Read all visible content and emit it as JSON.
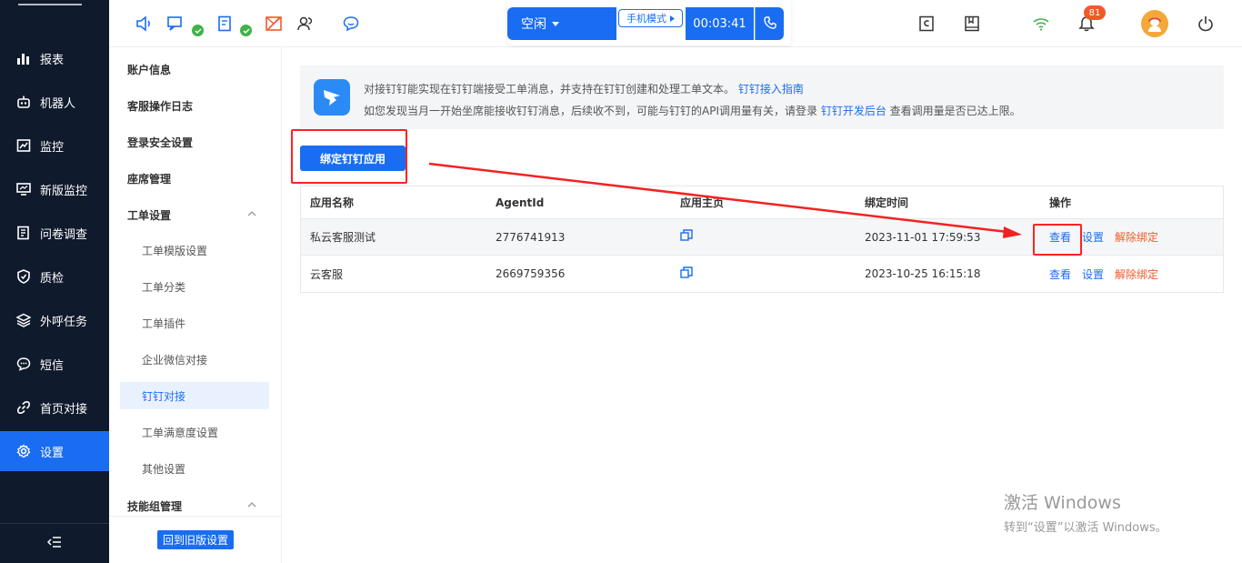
{
  "sidebar": {
    "items": [
      {
        "label": "报表",
        "icon": "bar-chart-icon"
      },
      {
        "label": "机器人",
        "icon": "robot-icon"
      },
      {
        "label": "监控",
        "icon": "monitor-chart-icon"
      },
      {
        "label": "新版监控",
        "icon": "screen-monitor-icon"
      },
      {
        "label": "问卷调查",
        "icon": "survey-icon"
      },
      {
        "label": "质检",
        "icon": "shield-check-icon"
      },
      {
        "label": "外呼任务",
        "icon": "layers-icon"
      },
      {
        "label": "短信",
        "icon": "message-icon"
      },
      {
        "label": "首页对接",
        "icon": "link-icon"
      },
      {
        "label": "设置",
        "icon": "gear-icon"
      }
    ],
    "active_index": 9,
    "collapse_icon": "collapse-menu-icon"
  },
  "header": {
    "call": {
      "status_label": "空闲",
      "mode_label": "手机模式",
      "timer": "00:03:41"
    },
    "notification_count": "81"
  },
  "submenu": {
    "items": [
      {
        "label": "账户信息",
        "type": "group"
      },
      {
        "label": "客服操作日志",
        "type": "group"
      },
      {
        "label": "登录安全设置",
        "type": "group"
      },
      {
        "label": "座席管理",
        "type": "group"
      },
      {
        "label": "工单设置",
        "type": "group",
        "expanded": true
      },
      {
        "label": "工单模版设置",
        "type": "child"
      },
      {
        "label": "工单分类",
        "type": "child"
      },
      {
        "label": "工单插件",
        "type": "child"
      },
      {
        "label": "企业微信对接",
        "type": "child"
      },
      {
        "label": "钉钉对接",
        "type": "child",
        "active": true
      },
      {
        "label": "工单满意度设置",
        "type": "child"
      },
      {
        "label": "其他设置",
        "type": "child"
      },
      {
        "label": "技能组管理",
        "type": "group",
        "expanded": true
      }
    ],
    "footer_button": "回到旧版设置"
  },
  "content": {
    "info": {
      "line1_text": "对接钉钉能实现在钉钉端接受工单消息，并支持在钉钉创建和处理工单文本。",
      "line1_link": "钉钉接入指南",
      "line2_pre": "如您发现当月一开始坐席能接收钉钉消息，后续收不到，可能与钉钉的API调用量有关，请登录",
      "line2_link": "钉钉开发后台",
      "line2_post": "查看调用量是否已达上限。"
    },
    "bind_button": "绑定钉钉应用",
    "table": {
      "columns": [
        "应用名称",
        "AgentId",
        "应用主页",
        "绑定时间",
        "操作"
      ],
      "rows": [
        {
          "name": "私云客服测试",
          "agent_id": "2776741913",
          "bind_time": "2023-11-01 17:59:53"
        },
        {
          "name": "云客服",
          "agent_id": "2669759356",
          "bind_time": "2023-10-25 16:15:18"
        }
      ],
      "actions": {
        "view": "查看",
        "settings": "设置",
        "unbind": "解除绑定"
      }
    }
  },
  "watermark": {
    "line1": "激活 Windows",
    "line2": "转到“设置”以激活 Windows。"
  },
  "colors": {
    "sidebar_bg": "#0f1a2c",
    "primary": "#1a6df2",
    "danger": "#f05a28",
    "highlight": "#f22222"
  }
}
